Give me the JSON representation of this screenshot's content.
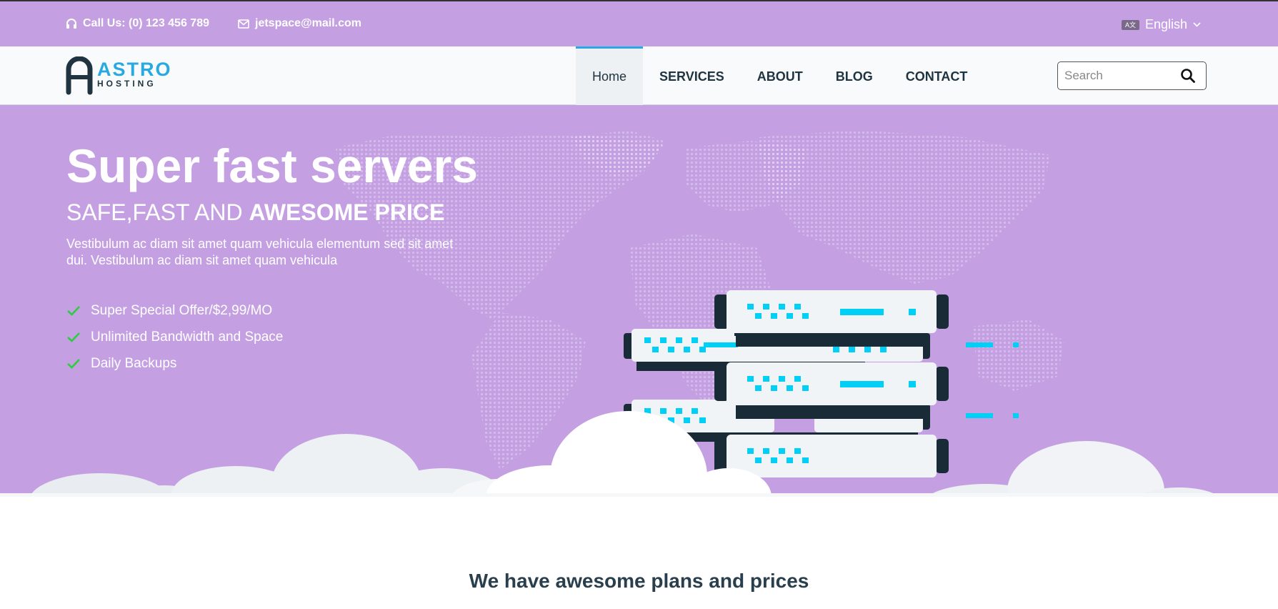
{
  "topbar": {
    "phone": "Call Us: (0) 123 456 789",
    "email": "jetspace@mail.com",
    "language": "English",
    "language_icon_text": "A文"
  },
  "logo": {
    "name": "ASTRO",
    "tagline": "HOSTING",
    "color": "#29a9e1"
  },
  "nav": {
    "items": [
      {
        "label": "Home",
        "active": true
      },
      {
        "label": "SERVICES"
      },
      {
        "label": "ABOUT"
      },
      {
        "label": "BLOG"
      },
      {
        "label": "CONTACT"
      }
    ],
    "search_placeholder": "Search"
  },
  "hero": {
    "title_bold": "Super fast",
    "title_light": " servers",
    "subtitle_light": "SAFE,FAST AND ",
    "subtitle_bold": "AWESOME PRICE",
    "description": "Vestibulum ac diam sit amet quam vehicula elementum sed sit amet dui. Vestibulum ac diam sit amet quam vehicula",
    "features": [
      "Super Special Offer/$2,99/MO",
      "Unlimited Bandwidth and Space",
      "Daily Backups"
    ],
    "background": "#c4a0e3",
    "check_color": "#2ecc40"
  },
  "plans": {
    "title": "We have awesome plans and prices"
  }
}
